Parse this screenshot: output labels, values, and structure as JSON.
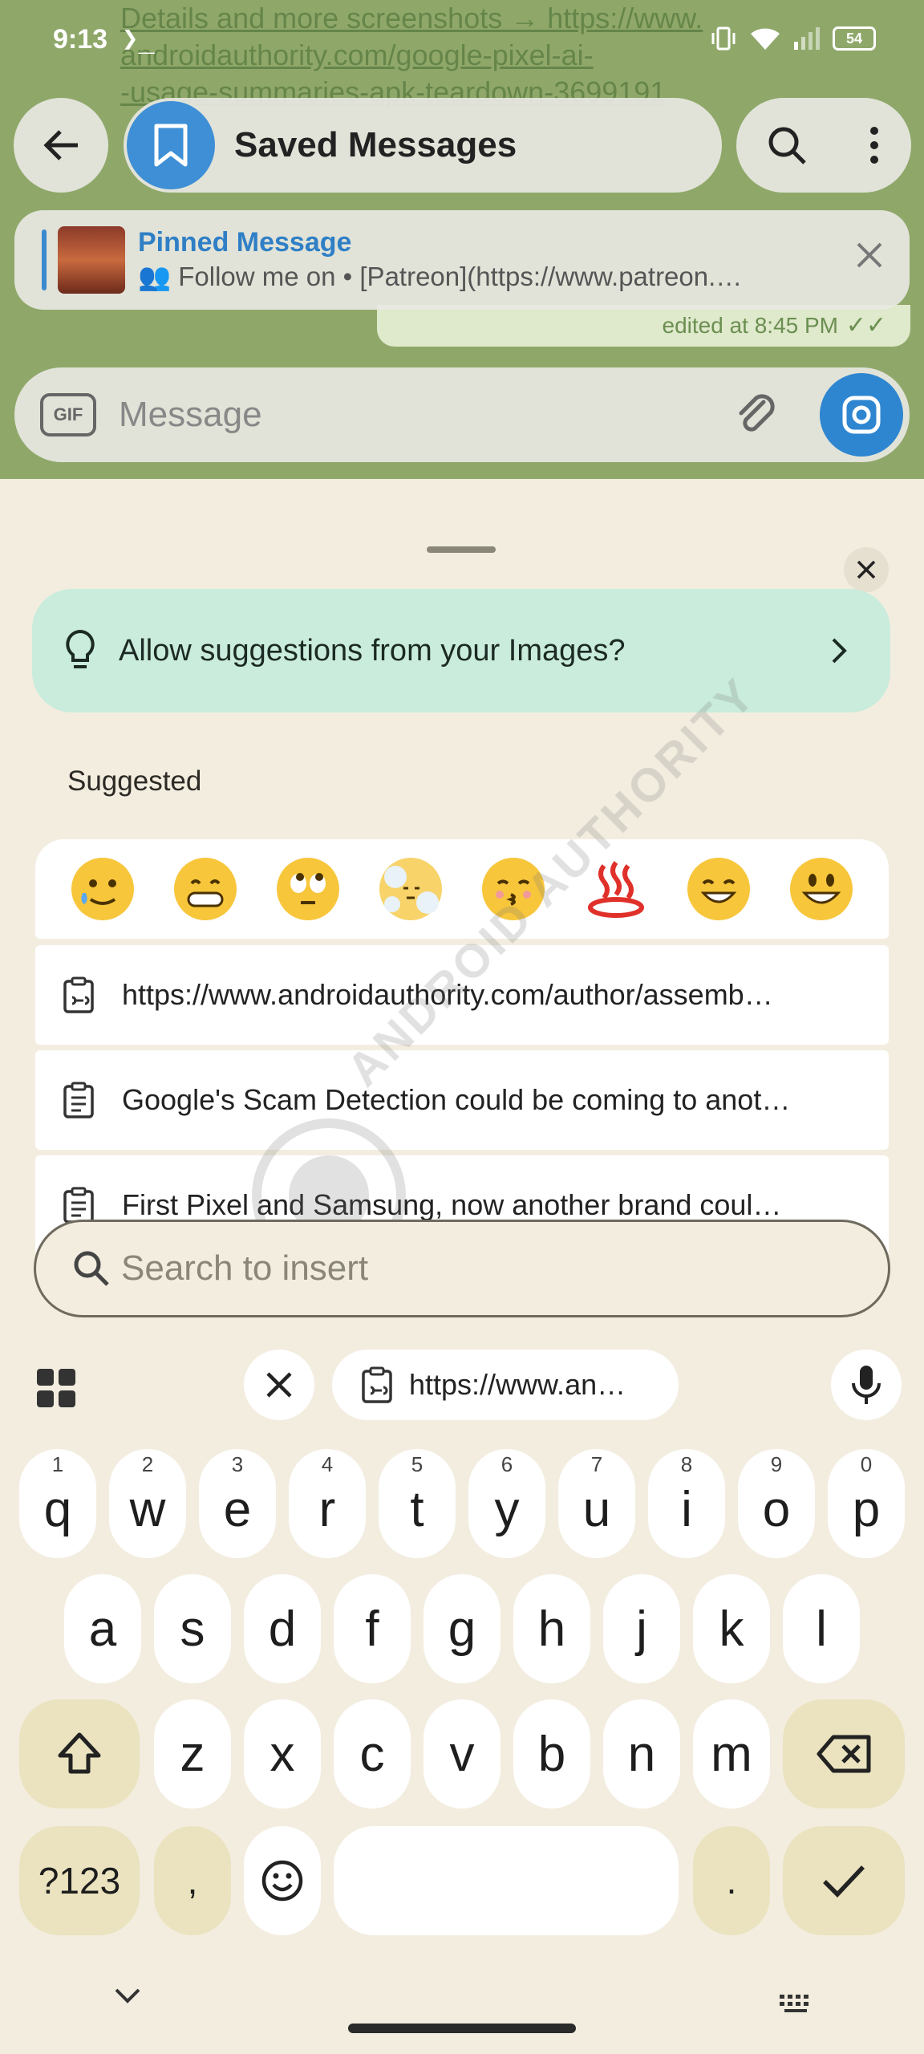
{
  "status_bar": {
    "time": "9:13",
    "terminal_glyph": "❯_",
    "battery": "54"
  },
  "chat": {
    "background_url_lines": [
      "Details and more screenshots → https://www.",
      "androidauthority.com/google-pixel-ai-",
      "-usage-summaries-apk-teardown-3699191"
    ],
    "title": "Saved Messages",
    "pinned": {
      "title": "Pinned Message",
      "preview": "👥 Follow me on • [Patreon](https://www.patreon.…"
    },
    "edited_label": "edited at 8:45 PM",
    "message_placeholder": "Message",
    "gif_label": "GIF"
  },
  "sheet": {
    "allow_banner": "Allow suggestions from your Images?",
    "suggested_label": "Suggested",
    "emojis": [
      "🥲",
      "😁",
      "🙄",
      "😶‍🌫️",
      "😚",
      "♨️",
      "😄",
      "😃"
    ],
    "clipboard_items": [
      {
        "text": "https://www.androidauthority.com/author/assemb…",
        "icon": "clipboard-link-icon"
      },
      {
        "text": "Google's Scam Detection could be coming to anot…",
        "icon": "clipboard-text-icon"
      },
      {
        "text": "First Pixel and Samsung, now another brand coul…",
        "icon": "clipboard-text-icon"
      }
    ],
    "search_placeholder": "Search to insert",
    "watermark": "ANDROID AUTHORITY"
  },
  "keyboard": {
    "clip_chip": "https://www.an…",
    "row1": [
      [
        "q",
        "1"
      ],
      [
        "w",
        "2"
      ],
      [
        "e",
        "3"
      ],
      [
        "r",
        "4"
      ],
      [
        "t",
        "5"
      ],
      [
        "y",
        "6"
      ],
      [
        "u",
        "7"
      ],
      [
        "i",
        "8"
      ],
      [
        "o",
        "9"
      ],
      [
        "p",
        "0"
      ]
    ],
    "row2": [
      "a",
      "s",
      "d",
      "f",
      "g",
      "h",
      "j",
      "k",
      "l"
    ],
    "row3": [
      "z",
      "x",
      "c",
      "v",
      "b",
      "n",
      "m"
    ],
    "symbols_label": "?123",
    "comma": ",",
    "period": "."
  },
  "colors": {
    "accent_blue": "#2e86d1",
    "banner_green": "#c9ecdc",
    "function_key": "#ebe3bf",
    "sheet_bg": "#f3ede0"
  }
}
